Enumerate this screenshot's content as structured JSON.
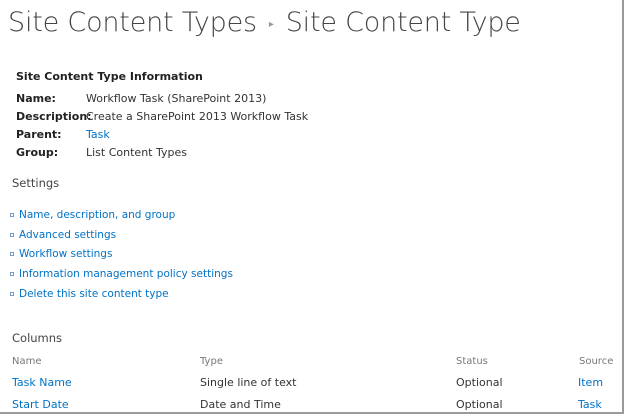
{
  "breadcrumb": {
    "parent": "Site Content Types",
    "current": "Site Content Type"
  },
  "info": {
    "heading": "Site Content Type Information",
    "rows": [
      {
        "label": "Name:",
        "value": "Workflow Task (SharePoint 2013)"
      },
      {
        "label": "Description:",
        "value": "Create a SharePoint 2013 Workflow Task"
      },
      {
        "label": "Parent:",
        "value": "Task"
      },
      {
        "label": "Group:",
        "value": "List Content Types"
      }
    ]
  },
  "settings": {
    "title": "Settings",
    "items": [
      "Name, description, and group",
      "Advanced settings",
      "Workflow settings",
      "Information management policy settings",
      "Delete this site content type"
    ]
  },
  "columns": {
    "title": "Columns",
    "headers": [
      "Name",
      "Type",
      "Status",
      "Source"
    ],
    "rows": [
      [
        "Task Name",
        "Single line of text",
        "Optional",
        "Item"
      ],
      [
        "Start Date",
        "Date and Time",
        "Optional",
        "Task"
      ]
    ]
  },
  "colors": {
    "link": "#0072c6",
    "text": "#333333",
    "muted": "#777777"
  }
}
